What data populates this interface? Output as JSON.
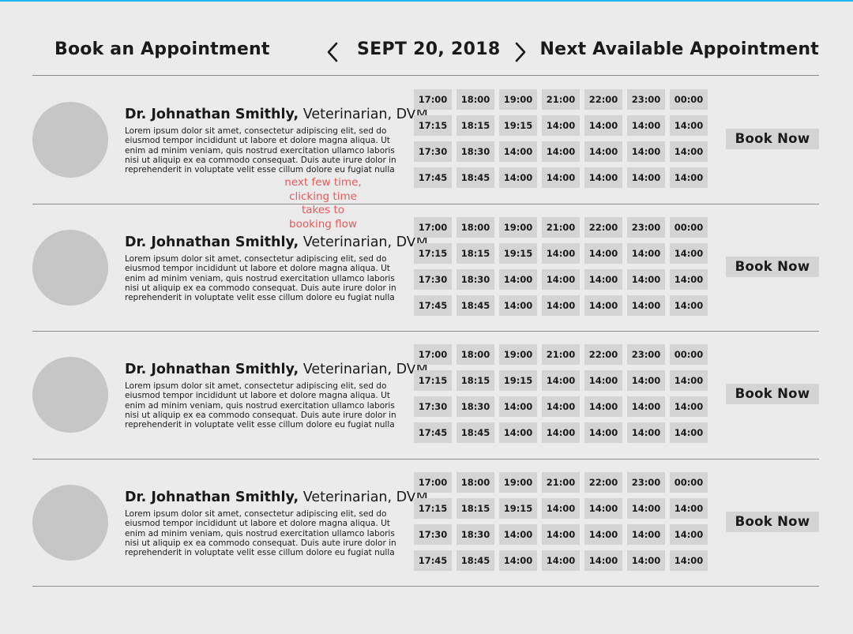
{
  "header": {
    "title": "Book an Appointment",
    "date": "SEPT 20, 2018",
    "next_available": "Next Available Appointment",
    "prev_icon": "chevron-left-icon",
    "next_icon": "chevron-right-icon"
  },
  "annotation": {
    "lines": [
      "next few time,",
      "clicking time",
      "takes to",
      "booking flow"
    ],
    "color": "#e85a5a"
  },
  "colors": {
    "background": "#ebebeb",
    "slot": "#d4d4d4",
    "avatar": "#c6c6c6",
    "accent": "#22b8f0"
  },
  "doctors": [
    {
      "name": "Dr. Johnathan Smithly,",
      "title": " Veterinarian, DVM",
      "description": "Lorem ipsum dolor sit amet, consectetur adipiscing elit, sed do eiusmod tempor incididunt ut labore et dolore magna aliqua. Ut enim ad minim veniam, quis nostrud exercitation ullamco laboris nisi ut aliquip ex ea commodo consequat. Duis aute irure dolor in reprehenderit in voluptate velit esse cillum dolore eu fugiat nulla",
      "book_label": "Book Now",
      "slots": [
        [
          "17:00",
          "18:00",
          "19:00",
          "21:00",
          "22:00",
          "23:00",
          "00:00"
        ],
        [
          "17:15",
          "18:15",
          "19:15",
          "14:00",
          "14:00",
          "14:00",
          "14:00"
        ],
        [
          "17:30",
          "18:30",
          "14:00",
          "14:00",
          "14:00",
          "14:00",
          "14:00"
        ],
        [
          "17:45",
          "18:45",
          "14:00",
          "14:00",
          "14:00",
          "14:00",
          "14:00"
        ]
      ]
    },
    {
      "name": "Dr. Johnathan Smithly,",
      "title": " Veterinarian, DVM",
      "description": "Lorem ipsum dolor sit amet, consectetur adipiscing elit, sed do eiusmod tempor incididunt ut labore et dolore magna aliqua. Ut enim ad minim veniam, quis nostrud exercitation ullamco laboris nisi ut aliquip ex ea commodo consequat. Duis aute irure dolor in reprehenderit in voluptate velit esse cillum dolore eu fugiat nulla",
      "book_label": "Book Now",
      "slots": [
        [
          "17:00",
          "18:00",
          "19:00",
          "21:00",
          "22:00",
          "23:00",
          "00:00"
        ],
        [
          "17:15",
          "18:15",
          "19:15",
          "14:00",
          "14:00",
          "14:00",
          "14:00"
        ],
        [
          "17:30",
          "18:30",
          "14:00",
          "14:00",
          "14:00",
          "14:00",
          "14:00"
        ],
        [
          "17:45",
          "18:45",
          "14:00",
          "14:00",
          "14:00",
          "14:00",
          "14:00"
        ]
      ]
    },
    {
      "name": "Dr. Johnathan Smithly,",
      "title": " Veterinarian, DVM",
      "description": "Lorem ipsum dolor sit amet, consectetur adipiscing elit, sed do eiusmod tempor incididunt ut labore et dolore magna aliqua. Ut enim ad minim veniam, quis nostrud exercitation ullamco laboris nisi ut aliquip ex ea commodo consequat. Duis aute irure dolor in reprehenderit in voluptate velit esse cillum dolore eu fugiat nulla",
      "book_label": "Book Now",
      "slots": [
        [
          "17:00",
          "18:00",
          "19:00",
          "21:00",
          "22:00",
          "23:00",
          "00:00"
        ],
        [
          "17:15",
          "18:15",
          "19:15",
          "14:00",
          "14:00",
          "14:00",
          "14:00"
        ],
        [
          "17:30",
          "18:30",
          "14:00",
          "14:00",
          "14:00",
          "14:00",
          "14:00"
        ],
        [
          "17:45",
          "18:45",
          "14:00",
          "14:00",
          "14:00",
          "14:00",
          "14:00"
        ]
      ]
    },
    {
      "name": "Dr. Johnathan Smithly,",
      "title": " Veterinarian, DVM",
      "description": "Lorem ipsum dolor sit amet, consectetur adipiscing elit, sed do eiusmod tempor incididunt ut labore et dolore magna aliqua. Ut enim ad minim veniam, quis nostrud exercitation ullamco laboris nisi ut aliquip ex ea commodo consequat. Duis aute irure dolor in reprehenderit in voluptate velit esse cillum dolore eu fugiat nulla",
      "book_label": "Book Now",
      "slots": [
        [
          "17:00",
          "18:00",
          "19:00",
          "21:00",
          "22:00",
          "23:00",
          "00:00"
        ],
        [
          "17:15",
          "18:15",
          "19:15",
          "14:00",
          "14:00",
          "14:00",
          "14:00"
        ],
        [
          "17:30",
          "18:30",
          "14:00",
          "14:00",
          "14:00",
          "14:00",
          "14:00"
        ],
        [
          "17:45",
          "18:45",
          "14:00",
          "14:00",
          "14:00",
          "14:00",
          "14:00"
        ]
      ]
    }
  ]
}
